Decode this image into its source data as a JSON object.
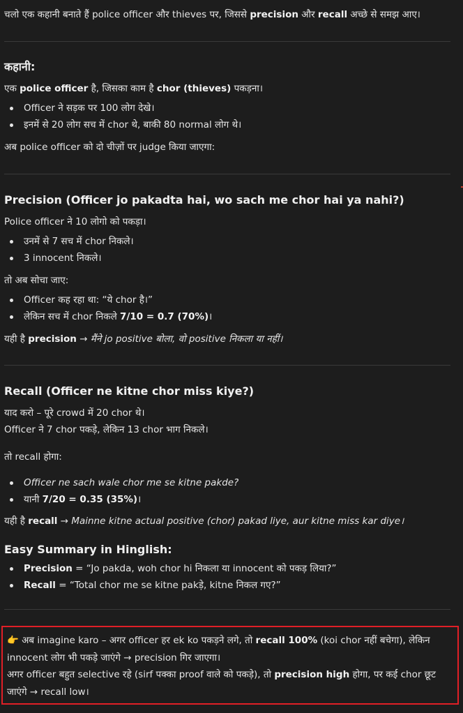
{
  "intro": {
    "a": "चलो एक कहानी बनाते हैं police officer और thieves पर, जिससे ",
    "precision": "precision",
    "b": " और ",
    "recall": "recall",
    "c": " अच्छे से समझ आए।"
  },
  "story": {
    "heading": "कहानी:",
    "line1_a": "एक ",
    "line1_b": "police officer",
    "line1_c": " है, जिसका काम है ",
    "line1_d": "chor (thieves)",
    "line1_e": " पकड़ना।",
    "bullets": [
      "Officer ने सड़क पर 100 लोग देखे।",
      "इनमें से 20 लोग सच में chor थे, बाकी 80 normal लोग थे।"
    ],
    "judge": "अब police officer को दो चीज़ों पर judge किया जाएगा:"
  },
  "precision_section": {
    "heading": "Precision (Officer jo pakadta hai, wo sach me chor hai ya nahi?)",
    "line1": "Police officer ने 10 लोगो को पकड़ा।",
    "bullets1": [
      "उनमें से 7 सच में chor निकले।",
      "3 innocent निकले।"
    ],
    "think": "तो अब सोचा जाए:",
    "bullet2_1": "Officer कह रहा था: “ये chor है।”",
    "bullet2_2_a": "लेकिन सच में chor निकले ",
    "bullet2_2_b": "7/10 = 0.7 (70%)",
    "bullet2_2_c": "।",
    "final_a": "यही है ",
    "final_b": "precision",
    "final_c": " → मैंने jo positive बोला, वो positive निकला या नहीं।"
  },
  "recall_section": {
    "heading": "Recall (Officer ne kitne chor miss kiye?)",
    "line1": "याद करो – पूरे crowd में 20 chor थे।",
    "line2": "Officer ने 7 chor पकड़े, लेकिन 13 chor भाग निकले।",
    "line3": "तो recall होगा:",
    "bullet1": "Officer ne sach wale chor me se kitne pakde?",
    "bullet2_a": "यानी ",
    "bullet2_b": "7/20 = 0.35 (35%)",
    "bullet2_c": "।",
    "final_a": "यही है ",
    "final_b": "recall",
    "final_c": " → Mainne kitne actual positive (chor) pakad liye, aur kitne miss kar diye।"
  },
  "summary": {
    "heading": "Easy Summary in Hinglish:",
    "p_label": "Precision",
    "p_text": " = “Jo pakda, woh chor hi निकला या innocent को पकड़ लिया?”",
    "r_label": "Recall",
    "r_text": " = “Total chor me se kitne pakड़े, kitne निकल गए?”"
  },
  "callout": {
    "icon": "pointing-hand-icon",
    "l1_a": " अब imagine karo – अगर officer हर ek ko पकड़ने लगे, तो ",
    "l1_b": "recall 100%",
    "l1_c": " (koi chor नहीं बचेगा), लेकिन innocent लोग भी पकड़े जाएंगे → precision गिर जाएगा।",
    "l2_a": "अगर officer बहुत selective रहे (sirf पक्का proof वाले को पकड़े), तो ",
    "l2_b": "precision high",
    "l2_c": " होगा, पर कई chor छूट जाएंगे → recall low।"
  },
  "colors": {
    "background": "#1d1d1d",
    "text": "#e6e6e6",
    "highlight_border": "#e11f26"
  }
}
